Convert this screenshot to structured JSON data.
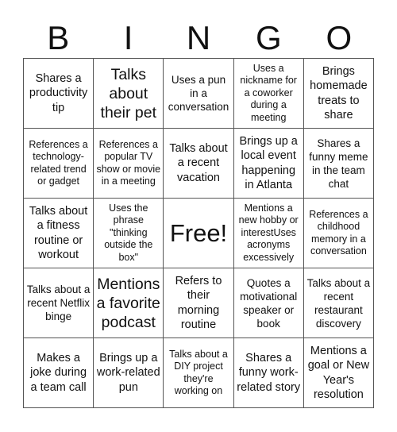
{
  "title_letters": [
    "B",
    "I",
    "N",
    "G",
    "O"
  ],
  "grid": [
    [
      {
        "text": "Shares a productivity tip",
        "size": "m"
      },
      {
        "text": "Talks about their pet",
        "size": "l"
      },
      {
        "text": "Uses a pun in a conversation",
        "size": "s"
      },
      {
        "text": "Uses a nickname for a coworker during a meeting",
        "size": "xs"
      },
      {
        "text": "Brings homemade treats to share",
        "size": "m"
      }
    ],
    [
      {
        "text": "References a technology-related trend or gadget",
        "size": "xs"
      },
      {
        "text": "References a popular TV show or movie in a meeting",
        "size": "xs"
      },
      {
        "text": "Talks about a recent vacation",
        "size": "m"
      },
      {
        "text": "Brings up a local event happening in Atlanta",
        "size": "m"
      },
      {
        "text": "Shares a funny meme in the team chat",
        "size": "s"
      }
    ],
    [
      {
        "text": "Talks about a fitness routine or workout",
        "size": "m"
      },
      {
        "text": "Uses the phrase \"thinking outside the box\"",
        "size": "xs"
      },
      {
        "text": "Free!",
        "size": "xl",
        "free": true
      },
      {
        "text": "Mentions a new hobby or interestUses acronyms excessively",
        "size": "xs"
      },
      {
        "text": "References a childhood memory in a conversation",
        "size": "xs"
      }
    ],
    [
      {
        "text": "Talks about a recent Netflix binge",
        "size": "s"
      },
      {
        "text": "Mentions a favorite podcast",
        "size": "l"
      },
      {
        "text": "Refers to their morning routine",
        "size": "m"
      },
      {
        "text": "Quotes a motivational speaker or book",
        "size": "s"
      },
      {
        "text": "Talks about a recent restaurant discovery",
        "size": "s"
      }
    ],
    [
      {
        "text": "Makes a joke during a team call",
        "size": "m"
      },
      {
        "text": "Brings up a work-related pun",
        "size": "m"
      },
      {
        "text": "Talks about a DIY project they're working on",
        "size": "xs"
      },
      {
        "text": "Shares a funny work-related story",
        "size": "m"
      },
      {
        "text": "Mentions a goal or New Year's resolution",
        "size": "m"
      }
    ]
  ]
}
